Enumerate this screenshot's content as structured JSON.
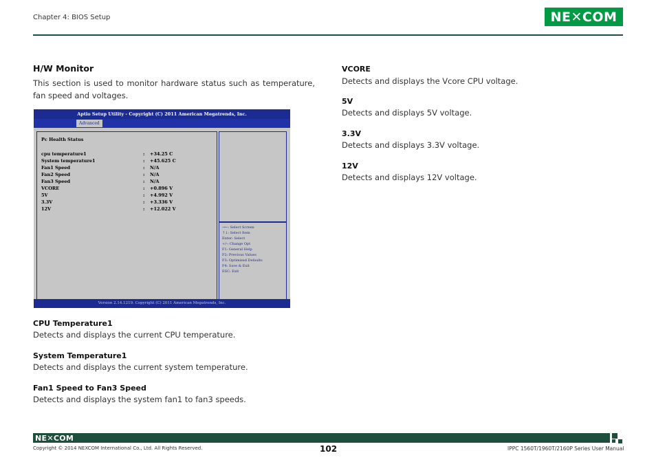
{
  "header": {
    "chapter": "Chapter 4: BIOS Setup",
    "logo_text": "NE✕COM"
  },
  "section": {
    "title": "H/W Monitor",
    "description": "This section is used to monitor hardware status such as temperature, fan speed and voltages."
  },
  "bios": {
    "title": "Aptio Setup Utility - Copyright (C) 2011 American Megatrends, Inc.",
    "tab": "Advanced",
    "panel_title": "Pc Health Status",
    "rows": [
      {
        "label": "cpu temperature1",
        "value": "+34.25 C"
      },
      {
        "label": "System temperature1",
        "value": "+45.625 C"
      },
      {
        "label": "Fan1 Speed",
        "value": "N/A"
      },
      {
        "label": "Fan2 Speed",
        "value": "N/A"
      },
      {
        "label": "Fan3 Speed",
        "value": "N/A"
      },
      {
        "label": "VCORE",
        "value": "+0.896 V"
      },
      {
        "label": "5V",
        "value": "+4.992 V"
      },
      {
        "label": "3.3V",
        "value": "+3.336 V"
      },
      {
        "label": "12V",
        "value": "+12.022 V"
      }
    ],
    "colon": ":",
    "help": [
      "→←: Select Screen",
      "↑↓: Select Item",
      "Enter: Select",
      "+/-: Change Opt",
      "F1: General Help",
      "F2: Previous Values",
      "F3: Optimized Defaults",
      "F4: Save & Exit",
      "ESC: Exit"
    ],
    "footer": "Version 2.14.1219. Copyright (C) 2011 American Megatrends, Inc."
  },
  "left_items": [
    {
      "title": "CPU Temperature1",
      "desc": "Detects and displays the current CPU temperature."
    },
    {
      "title": "System Temperature1",
      "desc": "Detects and displays the current system temperature."
    },
    {
      "title": "Fan1 Speed to Fan3 Speed",
      "desc": "Detects and displays the system fan1 to fan3 speeds."
    }
  ],
  "right_items": [
    {
      "title": "VCORE",
      "desc": "Detects and displays the Vcore CPU voltage."
    },
    {
      "title": "5V",
      "desc": "Detects and displays 5V voltage."
    },
    {
      "title": "3.3V",
      "desc": "Detects and displays 3.3V voltage."
    },
    {
      "title": "12V",
      "desc": "Detects and displays 12V voltage."
    }
  ],
  "footer": {
    "logo_text": "NE✕COM",
    "copyright": "Copyright © 2014 NEXCOM International Co., Ltd. All Rights Reserved.",
    "page_number": "102",
    "manual": "IPPC 1560T/1960T/2160P Series User Manual"
  },
  "colors": {
    "brand_green": "#009a44",
    "dark_green": "#1f4e3d",
    "bios_blue": "#1b2b92",
    "bios_gray": "#c6c6c6"
  }
}
